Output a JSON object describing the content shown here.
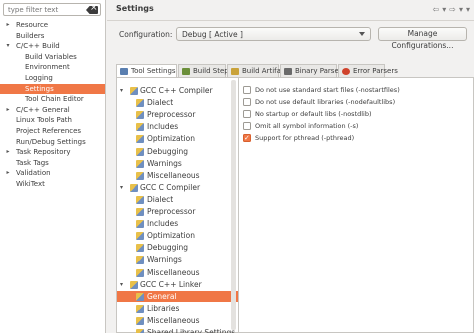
{
  "left_nav": {
    "filter_placeholder": "type filter text",
    "items": [
      {
        "label": "Resource",
        "expandable": true,
        "expanded": false,
        "indent": 0
      },
      {
        "label": "Builders",
        "expandable": false,
        "indent": 0
      },
      {
        "label": "C/C++ Build",
        "expandable": true,
        "expanded": true,
        "indent": 0
      },
      {
        "label": "Build Variables",
        "expandable": false,
        "indent": 1
      },
      {
        "label": "Environment",
        "expandable": false,
        "indent": 1
      },
      {
        "label": "Logging",
        "expandable": false,
        "indent": 1
      },
      {
        "label": "Settings",
        "expandable": false,
        "indent": 1,
        "selected": true
      },
      {
        "label": "Tool Chain Editor",
        "expandable": false,
        "indent": 1
      },
      {
        "label": "C/C++ General",
        "expandable": true,
        "expanded": false,
        "indent": 0
      },
      {
        "label": "Linux Tools Path",
        "expandable": false,
        "indent": 0
      },
      {
        "label": "Project References",
        "expandable": false,
        "indent": 0
      },
      {
        "label": "Run/Debug Settings",
        "expandable": false,
        "indent": 0
      },
      {
        "label": "Task Repository",
        "expandable": true,
        "expanded": false,
        "indent": 0
      },
      {
        "label": "Task Tags",
        "expandable": false,
        "indent": 0
      },
      {
        "label": "Validation",
        "expandable": true,
        "expanded": false,
        "indent": 0
      },
      {
        "label": "WikiText",
        "expandable": false,
        "indent": 0
      }
    ]
  },
  "header": {
    "title": "Settings"
  },
  "configuration": {
    "label": "Configuration:",
    "value": "Debug  [ Active ]",
    "manage_label": "Manage Configurations..."
  },
  "tabs": [
    {
      "label": "Tool Settings",
      "active": true
    },
    {
      "label": "Build Steps",
      "active": false
    },
    {
      "label": "Build Artifact",
      "active": false
    },
    {
      "label": "Binary Parsers",
      "active": false
    },
    {
      "label": "Error Parsers",
      "active": false
    }
  ],
  "tool_tree": [
    {
      "label": "GCC C++ Compiler",
      "type": "group"
    },
    {
      "label": "Dialect",
      "type": "child"
    },
    {
      "label": "Preprocessor",
      "type": "child"
    },
    {
      "label": "Includes",
      "type": "child"
    },
    {
      "label": "Optimization",
      "type": "child"
    },
    {
      "label": "Debugging",
      "type": "child"
    },
    {
      "label": "Warnings",
      "type": "child"
    },
    {
      "label": "Miscellaneous",
      "type": "child"
    },
    {
      "label": "GCC C Compiler",
      "type": "group"
    },
    {
      "label": "Dialect",
      "type": "child"
    },
    {
      "label": "Preprocessor",
      "type": "child"
    },
    {
      "label": "Includes",
      "type": "child"
    },
    {
      "label": "Optimization",
      "type": "child"
    },
    {
      "label": "Debugging",
      "type": "child"
    },
    {
      "label": "Warnings",
      "type": "child"
    },
    {
      "label": "Miscellaneous",
      "type": "child"
    },
    {
      "label": "GCC C++ Linker",
      "type": "group"
    },
    {
      "label": "General",
      "type": "child",
      "selected": true
    },
    {
      "label": "Libraries",
      "type": "child"
    },
    {
      "label": "Miscellaneous",
      "type": "child"
    },
    {
      "label": "Shared Library Settings",
      "type": "child"
    }
  ],
  "linker_options": [
    {
      "label": "Do not use standard start files (-nostartfiles)",
      "checked": false
    },
    {
      "label": "Do not use default libraries (-nodefaultlibs)",
      "checked": false
    },
    {
      "label": "No startup or default libs (-nostdlib)",
      "checked": false
    },
    {
      "label": "Omit all symbol information (-s)",
      "checked": false
    },
    {
      "label": "Support for pthread (-pthread)",
      "checked": true
    }
  ],
  "colors": {
    "selection": "#f07746",
    "background": "#f2f1f0",
    "text": "#3c3c3c"
  }
}
